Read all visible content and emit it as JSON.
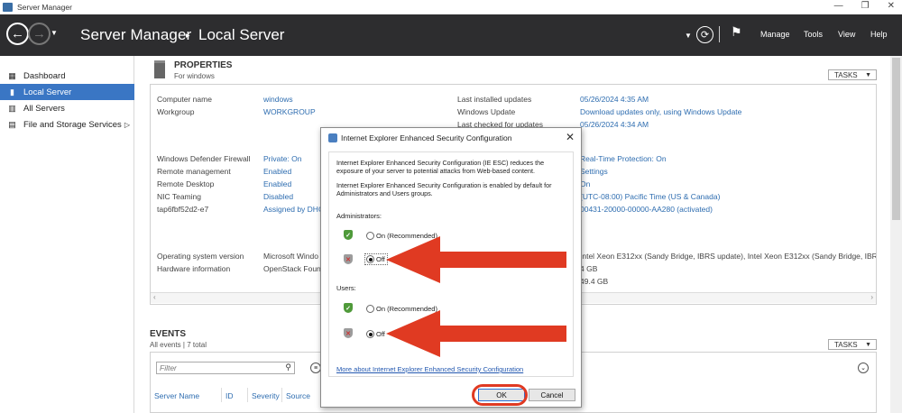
{
  "window": {
    "title": "Server Manager"
  },
  "header": {
    "breadcrumb_root": "Server Manager",
    "breadcrumb_sep": "▸",
    "breadcrumb_page": "Local Server",
    "menu": [
      "Manage",
      "Tools",
      "View",
      "Help"
    ]
  },
  "sidebar": {
    "items": [
      {
        "label": "Dashboard",
        "icon": "dashboard-icon"
      },
      {
        "label": "Local Server",
        "icon": "server-icon",
        "active": true
      },
      {
        "label": "All Servers",
        "icon": "servers-icon"
      },
      {
        "label": "File and Storage Services",
        "icon": "storage-icon",
        "expandable": true
      }
    ]
  },
  "properties": {
    "title": "PROPERTIES",
    "subtitle": "For windows",
    "tasks_label": "TASKS",
    "left": [
      {
        "label": "Computer name",
        "value": "windows"
      },
      {
        "label": "Workgroup",
        "value": "WORKGROUP"
      },
      {
        "label": "Windows Defender Firewall",
        "value": "Private: On"
      },
      {
        "label": "Remote management",
        "value": "Enabled"
      },
      {
        "label": "Remote Desktop",
        "value": "Enabled"
      },
      {
        "label": "NIC Teaming",
        "value": "Disabled"
      },
      {
        "label": "tap6fbf52d2-e7",
        "value": "Assigned by DHC"
      },
      {
        "label": "Operating system version",
        "value": "Microsoft Windo"
      },
      {
        "label": "Hardware information",
        "value": "OpenStack Found"
      }
    ],
    "right": [
      {
        "label": "Last installed updates",
        "value": "05/26/2024 4:35 AM"
      },
      {
        "label": "Windows Update",
        "value": "Download updates only, using Windows Update"
      },
      {
        "label": "Last checked for updates",
        "value": "05/26/2024 4:34 AM"
      }
    ],
    "right_partial": [
      "Real-Time Protection: On",
      "Settings",
      "On",
      "(UTC-08:00) Pacific Time (US & Canada)",
      "00431-20000-00000-AA280 (activated)",
      "Intel Xeon E312xx (Sandy Bridge, IBRS update), Intel Xeon E312xx (Sandy Bridge, IBRS upd",
      "4 GB",
      "49.4 GB"
    ]
  },
  "events": {
    "title": "EVENTS",
    "subtitle": "All events | 7 total",
    "tasks_label": "TASKS",
    "filter_placeholder": "Filter",
    "columns": [
      "Server Name",
      "ID",
      "Severity",
      "Source"
    ]
  },
  "dialog": {
    "title": "Internet Explorer Enhanced Security Configuration",
    "description": "Internet Explorer Enhanced Security Configuration (IE ESC) reduces the exposure of your server to potential attacks from Web-based content.",
    "default_note": "Internet Explorer Enhanced Security Configuration is enabled by default for Administrators and Users groups.",
    "administrators_label": "Administrators:",
    "users_label": "Users:",
    "on_label": "On (Recommended)",
    "off_label": "Off",
    "admin_selected": "Off",
    "users_selected": "Off",
    "link": "More about Internet Explorer Enhanced Security Configuration",
    "ok_label": "OK",
    "cancel_label": "Cancel"
  },
  "colors": {
    "accent": "#3a76c4",
    "link": "#2e6db0",
    "annotation": "#e03a22"
  }
}
